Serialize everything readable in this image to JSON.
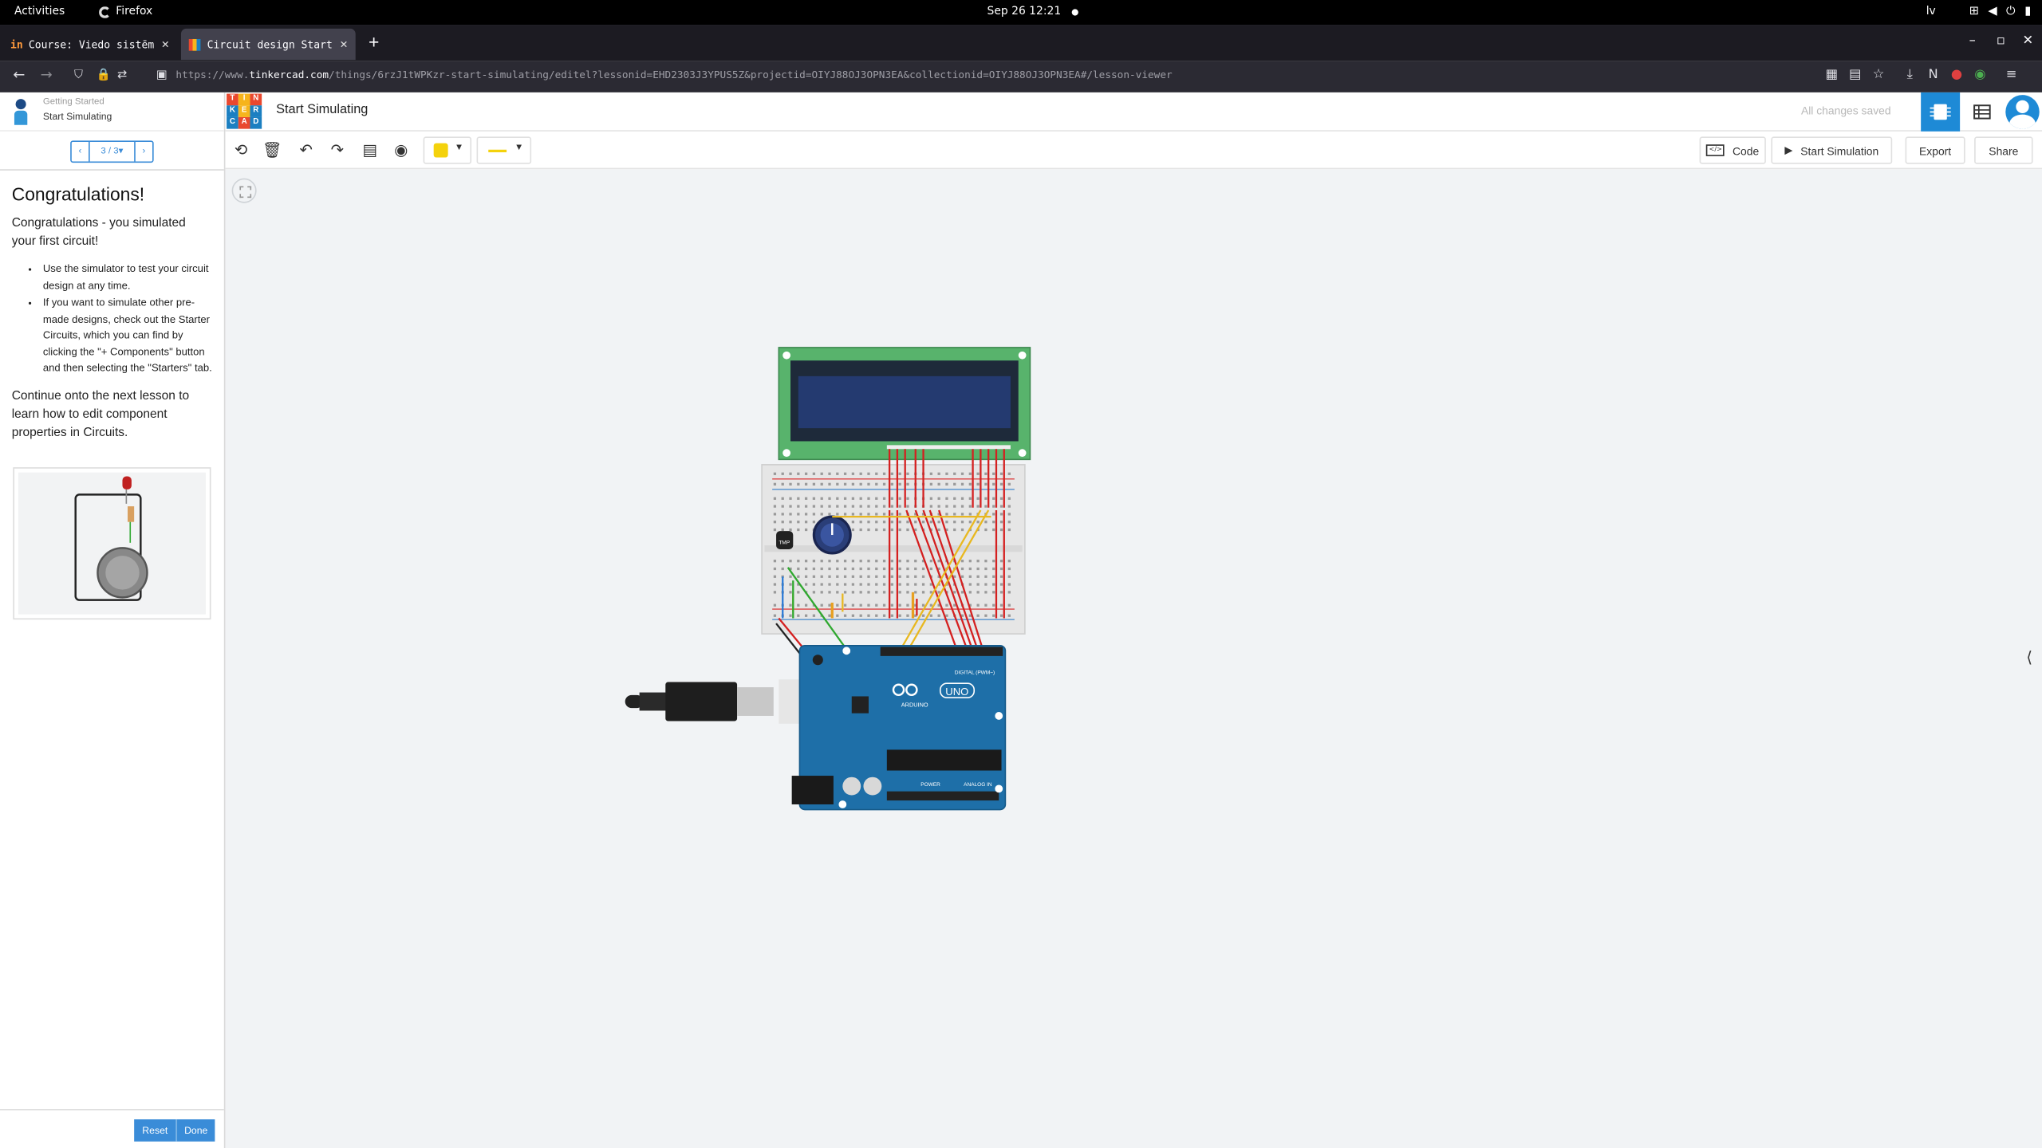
{
  "system_bar": {
    "activities": "Activities",
    "app_name": "Firefox",
    "clock": "Sep 26  12:21",
    "language": "lv"
  },
  "browser": {
    "tabs": [
      {
        "title": "Course: Viedo sistēmu iz"
      },
      {
        "title": "Circuit design Start Sim"
      }
    ],
    "url_prefix": "https://www.",
    "url_domain": "tinkercad.com",
    "url_rest": "/things/6rzJ1tWPKzr-start-simulating/editel?lessonid=EHD2303J3YPUS5Z&projectid=OIYJ88OJ3OPN3EA&collectionid=OIYJ88OJ3OPN3EA#/lesson-viewer"
  },
  "lesson": {
    "breadcrumb_parent": "Getting Started",
    "breadcrumb_current": "Start Simulating",
    "pager": "3 / 3",
    "title": "Congratulations!",
    "intro": "Congratulations - you simulated your first circuit!",
    "bullets": [
      "Use the simulator to test your circuit design at any time.",
      "If you want to simulate other pre-made designs, check out the Starter Circuits, which you can find by clicking the \"+ Components\" button and then selecting the \"Starters\" tab."
    ],
    "outro": "Continue onto the next lesson to learn how to edit component properties in Circuits.",
    "reset_label": "Reset",
    "done_label": "Done"
  },
  "editor": {
    "logo_letters": [
      "T",
      "I",
      "N",
      "K",
      "E",
      "R",
      "C",
      "A",
      "D"
    ],
    "title": "Start Simulating",
    "save_status": "All changes saved",
    "code_label": "Code",
    "start_sim_label": "Start Simulation",
    "export_label": "Export",
    "share_label": "Share",
    "wire_color": "#f4d20c"
  },
  "colors": {
    "accent": "#1e8ad6",
    "lesson_button": "#3a8cd8",
    "canvas_bg": "#f1f3f5"
  }
}
